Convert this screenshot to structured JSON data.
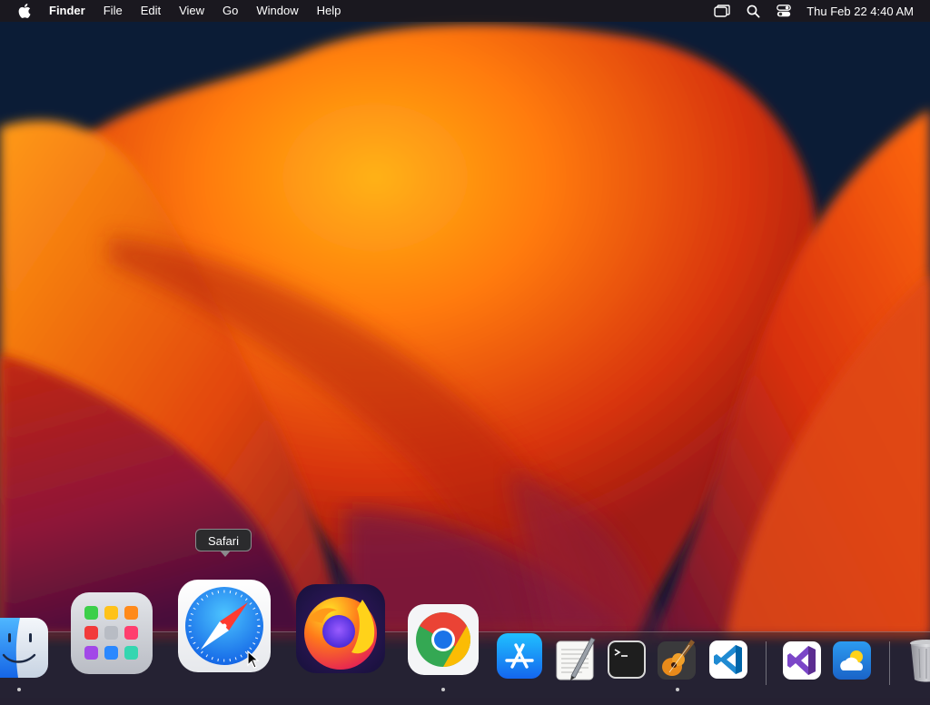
{
  "menubar": {
    "app_name": "Finder",
    "menus": [
      "File",
      "Edit",
      "View",
      "Go",
      "Window",
      "Help"
    ],
    "status_icons": [
      "screen-mirroring-icon",
      "spotlight-search-icon",
      "control-center-icon"
    ],
    "clock": "Thu Feb 22  4:40 AM"
  },
  "tooltip": {
    "text": "Safari"
  },
  "dock": {
    "items": [
      {
        "name": "Finder",
        "icon": "finder-icon",
        "running": true
      },
      {
        "name": "Launchpad",
        "icon": "launchpad-icon",
        "running": false
      },
      {
        "name": "Safari",
        "icon": "safari-icon",
        "running": false,
        "hovered": true
      },
      {
        "name": "Firefox",
        "icon": "firefox-icon",
        "running": false
      },
      {
        "name": "Google Chrome",
        "icon": "chrome-icon",
        "running": true
      },
      {
        "name": "App Store",
        "icon": "app-store-icon",
        "running": false
      },
      {
        "name": "TextEdit",
        "icon": "textedit-icon",
        "running": false
      },
      {
        "name": "Terminal",
        "icon": "terminal-icon",
        "running": false
      },
      {
        "name": "GarageBand",
        "icon": "garageband-icon",
        "running": true
      },
      {
        "name": "Visual Studio Code",
        "icon": "vscode-icon",
        "running": false
      },
      {
        "name": "Visual Studio",
        "icon": "visual-studio-icon",
        "running": false
      },
      {
        "name": "Weather",
        "icon": "weather-icon",
        "running": false
      },
      {
        "name": "Trash",
        "icon": "trash-icon",
        "running": false
      }
    ]
  },
  "colors": {
    "wallpaper_base": "#0a1a33",
    "wallpaper_orange": "#ff8a10",
    "wallpaper_red": "#d63a10",
    "wallpaper_magenta": "#7a1440",
    "safari_blue": "#1e7cf2"
  }
}
